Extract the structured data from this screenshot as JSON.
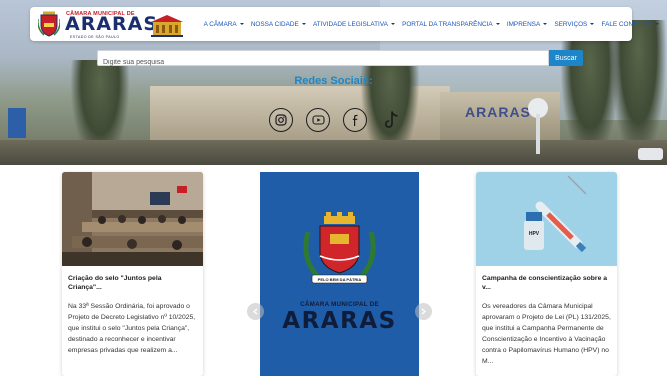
{
  "header": {
    "logo": {
      "top_text": "CÂMARA MUNICIPAL DE",
      "main_text": "ARARAS",
      "sub_text": "ESTADO DE SÃO PAULO"
    },
    "menu": [
      {
        "label": "A CÂMARA"
      },
      {
        "label": "NOSSA CIDADE"
      },
      {
        "label": "ATIVIDADE LEGISLATIVA"
      },
      {
        "label": "PORTAL DA TRANSPARÊNCIA"
      },
      {
        "label": "IMPRENSA"
      },
      {
        "label": "SERVIÇOS"
      },
      {
        "label": "FALE CONOSCO"
      }
    ]
  },
  "search": {
    "placeholder": "Digite sua pesquisa",
    "button_label": "Buscar"
  },
  "hero": {
    "background_sign": "ARARAS"
  },
  "social": {
    "title": "Redes Sociais:",
    "icons": [
      "instagram-icon",
      "youtube-icon",
      "facebook-icon",
      "tiktok-icon"
    ]
  },
  "news": [
    {
      "title": "Criação do selo \"Juntos pela Criança\"...",
      "text": "Na 33ª Sessão Ordinária, foi aprovado o Projeto de Decreto Legislativo nº 10/2025, que institui o selo \"Juntos pela Criança\", destinado a reconhecer e incentivar empresas privadas que realizem a..."
    },
    {
      "banner_top": "CÂMARA MUNICIPAL DE",
      "banner_main": "ARARAS",
      "motto": "PELO BEM DA PÁTRIA"
    },
    {
      "title": "Campanha de conscientização sobre a v...",
      "text": "Os vereadores da Câmara Municipal aprovaram o Projeto de Lei (PL) 131/2025, que institui a Campanha Permanente de Conscientização e Incentivo à Vacinação contra o Papilomavírus Humano (HPV) no M...",
      "vial_label": "HPV"
    }
  ],
  "colors": {
    "brand_blue": "#1b2f6f",
    "menu_blue": "#1b56b8",
    "accent": "#1d86c8",
    "brand_red": "#c62026",
    "center_card_blue": "#1f5da8"
  }
}
